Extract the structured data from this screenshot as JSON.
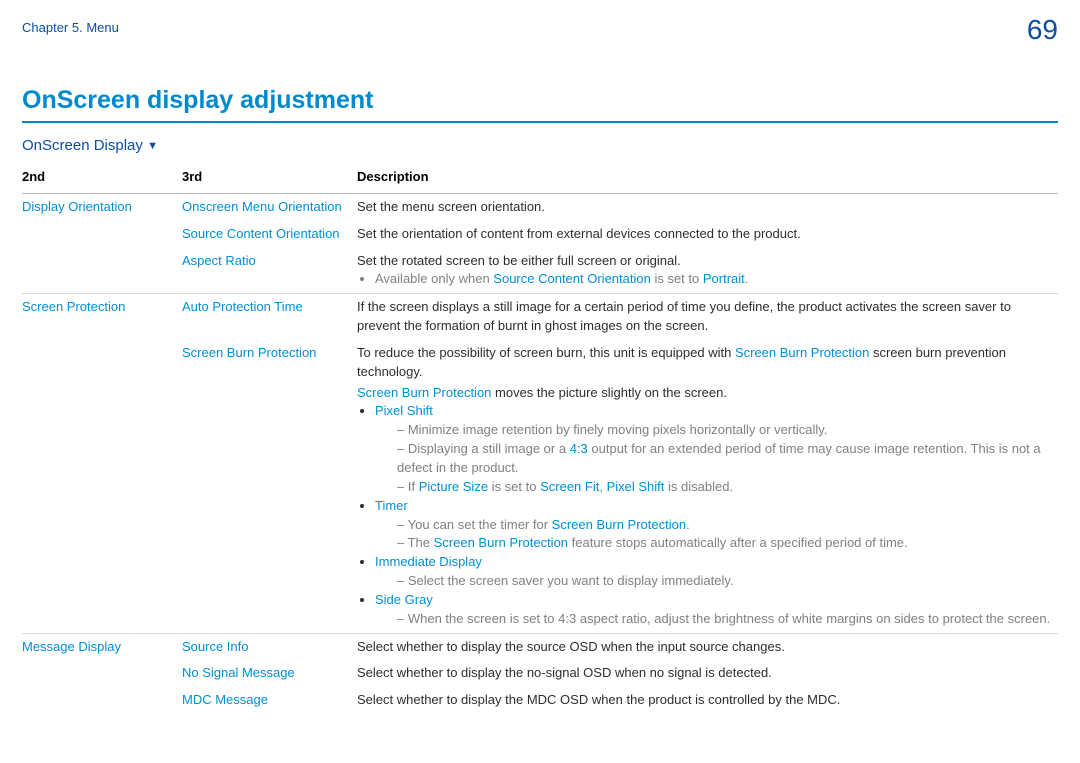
{
  "header": {
    "chapter": "Chapter 5. Menu",
    "page": "69"
  },
  "title": "OnScreen display adjustment",
  "section": "OnScreen Display",
  "columns": {
    "c1": "2nd",
    "c2": "3rd",
    "c3": "Description"
  },
  "terms": {
    "sco": "Source Content Orientation",
    "portrait": "Portrait",
    "sbp": "Screen Burn Protection",
    "ratio43": "4:3",
    "picsize": "Picture Size",
    "screenfit": "Screen Fit",
    "pixelshift": "Pixel Shift"
  },
  "groups": [
    {
      "second": "Display Orientation",
      "rows": [
        {
          "third": "Onscreen Menu Orientation",
          "desc": "Set the menu screen orientation."
        },
        {
          "third": "Source Content Orientation",
          "desc": "Set the orientation of content from external devices connected to the product."
        },
        {
          "third": "Aspect Ratio",
          "desc": "Set the rotated screen to be either full screen or original.",
          "note": {
            "pre": "Available only when ",
            "mid": " is set to ",
            "post": "."
          }
        }
      ]
    },
    {
      "second": "Screen Protection",
      "rows": [
        {
          "third": "Auto Protection Time",
          "desc": "If the screen displays a still image for a certain period of time you define, the product activates the screen saver to prevent the formation of burnt in ghost images on the screen."
        },
        {
          "third": "Screen Burn Protection",
          "desc_pre": "To reduce the possibility of screen burn, this unit is equipped with ",
          "desc_post": " screen burn prevention technology.",
          "moves": " moves the picture slightly on the screen.",
          "bullets": [
            {
              "head": "Pixel Shift",
              "subs": [
                "Minimize image retention by finely moving pixels horizontally or vertically.",
                {
                  "t1": "Displaying a still image or a ",
                  "t2": " output for an extended period of time may cause image retention. This is not a defect in the product."
                },
                {
                  "t1": "If ",
                  "t2": " is set to ",
                  "t3": ", ",
                  "t4": " is disabled."
                }
              ]
            },
            {
              "head": "Timer",
              "subs": [
                {
                  "t1": "You can set the timer for ",
                  "t2": "."
                },
                {
                  "t1": "The ",
                  "t2": " feature stops automatically after a specified period of time."
                }
              ]
            },
            {
              "head": "Immediate Display",
              "subs": [
                "Select the screen saver you want to display immediately."
              ]
            },
            {
              "head": "Side Gray",
              "subs": [
                "When the screen is set to 4:3 aspect ratio, adjust the brightness of white margins on sides to protect the screen."
              ]
            }
          ]
        }
      ]
    },
    {
      "second": "Message Display",
      "rows": [
        {
          "third": "Source Info",
          "desc": "Select whether to display the source OSD when the input source changes."
        },
        {
          "third": "No Signal Message",
          "desc": "Select whether to display the no-signal OSD when no signal is detected."
        },
        {
          "third": "MDC Message",
          "desc": "Select whether to display the MDC OSD when the product is controlled by the MDC."
        }
      ]
    }
  ]
}
